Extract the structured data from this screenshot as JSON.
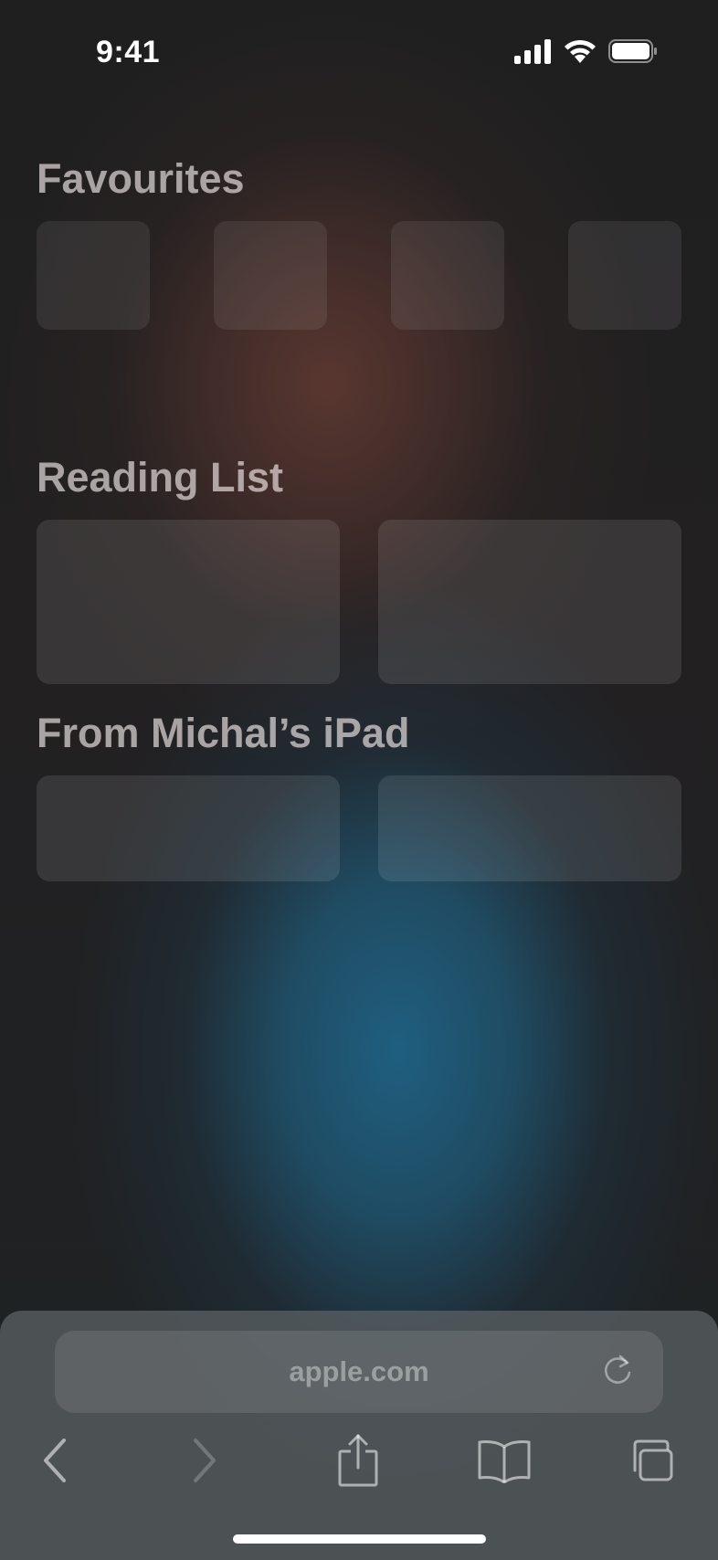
{
  "status_bar": {
    "time": "9:41",
    "icons": [
      "cellular-signal-icon",
      "wifi-icon",
      "battery-icon"
    ]
  },
  "sections": {
    "favourites": {
      "title": "Favourites"
    },
    "reading_list": {
      "title": "Reading List"
    },
    "from_device": {
      "title": "From Michal’s iPad"
    }
  },
  "toolbar": {
    "address": "apple.com",
    "icons": [
      "reload-icon",
      "back-chevron-icon",
      "forward-chevron-icon",
      "share-icon",
      "bookmarks-book-icon",
      "tabs-icon"
    ]
  },
  "colors": {
    "background": "#1e1f21",
    "warm_glow": "#5c3830",
    "cool_glow": "#1f6285",
    "toolbar": "#5a5f62"
  }
}
